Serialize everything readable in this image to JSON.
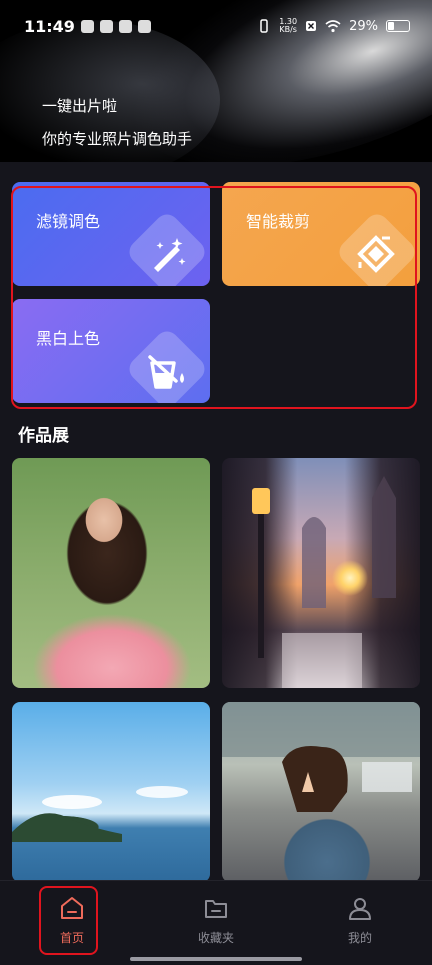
{
  "status_bar": {
    "time": "11:49",
    "net_speed_value": "1.30",
    "net_speed_unit": "KB/s",
    "battery": "29%",
    "battery_level": 0.29
  },
  "hero": {
    "line1": "一键出片啦",
    "line2": "你的专业照片调色助手"
  },
  "features": [
    {
      "label": "滤镜调色",
      "icon": "magic-wand-icon",
      "color": "#5a67f0"
    },
    {
      "label": "智能裁剪",
      "icon": "crop-icon",
      "color": "#f4a245"
    },
    {
      "label": "黑白上色",
      "icon": "paint-bucket-icon",
      "color": "#7068f1"
    }
  ],
  "section": {
    "gallery_title": "作品展"
  },
  "gallery": [
    {
      "subject": "portrait-woman-pink-dress"
    },
    {
      "subject": "city-street-sunset"
    },
    {
      "subject": "sea-island-sky"
    },
    {
      "subject": "girl-peace-sign-street"
    }
  ],
  "nav": {
    "home": "首页",
    "favorites": "收藏夹",
    "me": "我的",
    "active_color": "#ef6b5b",
    "inactive_color": "#8d8d96"
  },
  "annotation_color": "#e0141e"
}
